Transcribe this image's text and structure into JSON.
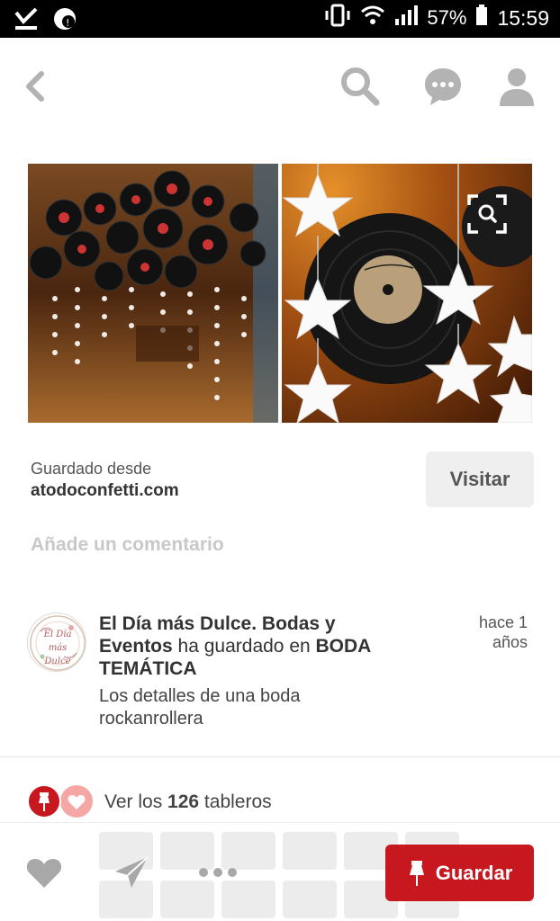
{
  "status_bar": {
    "battery": "57%",
    "time": "15:59"
  },
  "source": {
    "saved_from_label": "Guardado desde",
    "domain": "atodoconfetti.com",
    "visit_label": "Visitar"
  },
  "comment": {
    "placeholder": "Añade un comentario"
  },
  "pinner": {
    "name": "El Día más Dulce. Bodas y Eventos",
    "action": " ha guardado en ",
    "board": "BODA TEMÁTICA",
    "time_line1": "hace 1",
    "time_line2": "años",
    "description": "Los detalles de una boda rockanrollera",
    "avatar_text": "El Día más Dulce"
  },
  "boards": {
    "prefix": "Ver los ",
    "count": "126",
    "suffix": " tableros"
  },
  "bottom_bar": {
    "save_label": "Guardar"
  },
  "colors": {
    "accent_red": "#c8181f",
    "heart_pink": "#f4a7a4",
    "icon_gray": "#b3b3b3"
  },
  "icons": [
    "back-icon",
    "search-icon",
    "chat-icon",
    "profile-icon",
    "zoom-search-icon",
    "pin-icon",
    "heart-icon",
    "send-icon",
    "more-icon"
  ]
}
